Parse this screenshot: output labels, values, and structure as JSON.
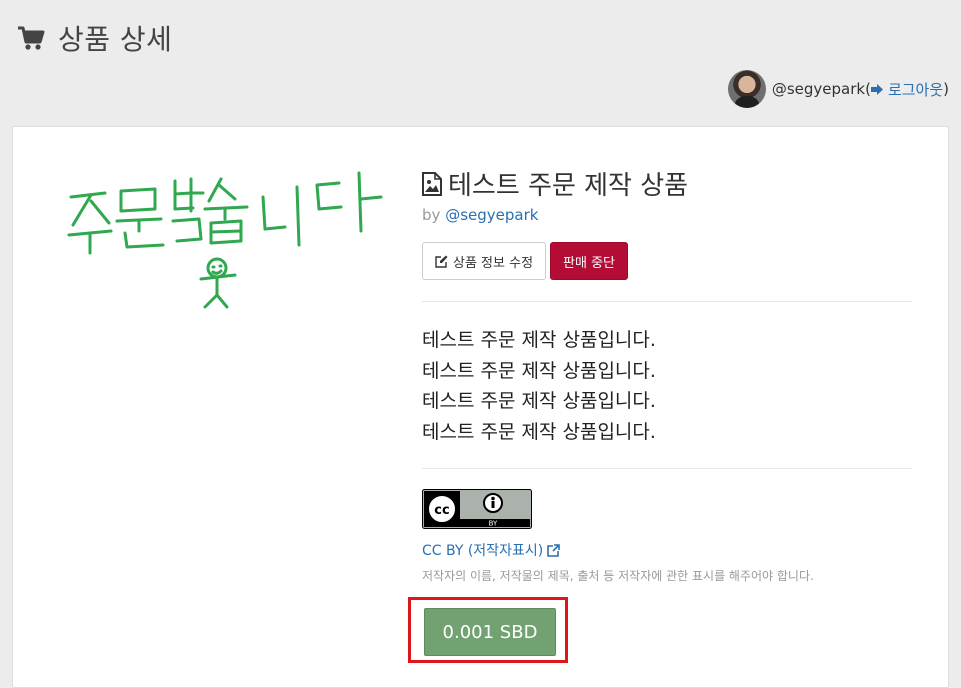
{
  "header": {
    "title": "상품 상세",
    "icon": "shopping-cart-icon"
  },
  "user": {
    "handle": "@segyepark",
    "open_paren": " (",
    "logout_label": "로그아웃",
    "close_paren": ")"
  },
  "product": {
    "image_text": "주문받습니다",
    "title": "테스트 주문 제작 상품",
    "by_label": "by",
    "author": "@segyepark",
    "edit_button": "상품 정보 수정",
    "stop_button": "판매 중단",
    "description_lines": [
      "테스트 주문 제작 상품입니다.",
      "테스트 주문 제작 상품입니다.",
      "테스트 주문 제작 상품입니다.",
      "테스트 주문 제작 상품입니다."
    ],
    "license": {
      "badge_cc": "cc",
      "badge_by": "BY",
      "link_text": "CC BY (저작자표시)",
      "description": "저작자의 이름, 저작물의 제목, 출처 등 저작자에 관한 표시를 해주어야 합니다."
    },
    "price": "0.001 SBD"
  },
  "colors": {
    "accent_link": "#2a6fb0",
    "stop_button": "#b30c35",
    "price_button": "#72a172",
    "highlight": "#e0141b",
    "handwriting": "#2fa84f"
  }
}
